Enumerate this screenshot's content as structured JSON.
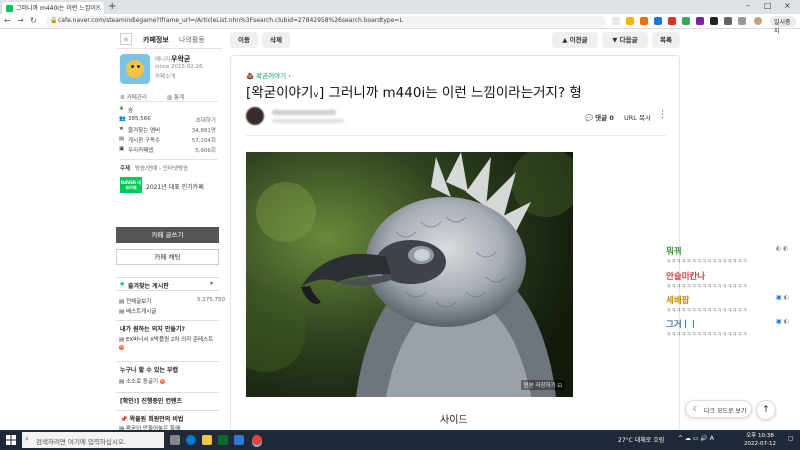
{
  "browser": {
    "tab_title": "그러니까 m440i는 이런 느낌이...",
    "url": "cafe.naver.com/steamindiegame?iframe_url=/ArticleList.nhn%3Fsearch.clubid=27842958%26search.boardtype=L",
    "profile_label": "일시중지"
  },
  "sidebar": {
    "tab_info": "카페정보",
    "tab_activity": "나의활동",
    "manager_label": "매니저",
    "manager_name": "우왁굳",
    "since": "since 2015.02.26.",
    "cafe_intro": "카페소개",
    "cafe_manage": "카페관리",
    "stats": "통계",
    "level_label": "숲",
    "members": "385,566",
    "invite": "초대하기",
    "rows": [
      {
        "label": "즐겨찾는 멤버",
        "value": "34,881명"
      },
      {
        "label": "게시판 구독수",
        "value": "57,204회"
      },
      {
        "label": "우리카페앱",
        "value": "5,906회"
      }
    ],
    "theme_label": "주제",
    "theme_value": "방송/연예 › 인터넷방송",
    "badge_text": "NAVER 대표카페",
    "badge_caption": "2021년 대표 인기카페",
    "write_button": "카페 글쓰기",
    "chat_button": "카페 채팅",
    "fav_header": "즐겨찾는 게시판",
    "fav_items": [
      {
        "label": "전체글보기",
        "count": "5,275,750"
      },
      {
        "label": "베스트게시글",
        "count": ""
      }
    ],
    "section1": "내가 원하는 의지 만들기?",
    "section1_item": "EX버너서 X박플원 2차 의자 준테스트",
    "section2": "누구나 할 수 있는 부캡",
    "section2_item": "소소로 둥글기",
    "section3": "[확인!] 진행중인 컨텐츠",
    "section4": "왁물원 회원만의 비법",
    "section4_item": "왁굳이 만들어놓은 특혜"
  },
  "article": {
    "btn_move": "이동",
    "btn_delete": "삭제",
    "btn_prev": "이전글",
    "btn_next": "다음글",
    "btn_list": "목록",
    "board_link": "왁굳이야기",
    "title": "[왁굳이야기ᵥ] 그러니까 m440i는 이런 느낌이라는거지? 형",
    "comments": "댓글 0",
    "url_copy": "URL 복사",
    "photo_caption": "원본 저장하기",
    "subtitle": "사이드"
  },
  "chat": [
    {
      "name": "뭐꿔",
      "color": "#3a9a3a",
      "text": "ㅋㅋㅋㅋㅋㅋㅋㅋㅋㅋㅋㅋㅋㅋㅋㅋ"
    },
    {
      "name": "안슬미칸나",
      "color": "#d63a3a",
      "text": "ㅋㅋㅋㅋㅋㅋㅋㅋㅋㅋㅋㅋㅋㅋㅋㅋ"
    },
    {
      "name": "세베팝",
      "color": "#c58a00",
      "text": "ㅋㅋㅋㅋㅋㅋㅋㅋㅋㅋㅋㅋㅋㅋㅋㅋ"
    },
    {
      "name": "그거ㅣㅣ",
      "color": "#3a7a9a",
      "text": "ㅋㅋㅋㅋㅋㅋㅋㅋㅋㅋㅋㅋㅋㅋㅋㅋ"
    }
  ],
  "darkmode": "다크 모드로 보기",
  "taskbar": {
    "search_placeholder": "검색하려면 여기에 입력하십시오.",
    "weather": "27°C 대체로 흐림",
    "time": "오후 10:38",
    "date": "2022-07-12"
  }
}
